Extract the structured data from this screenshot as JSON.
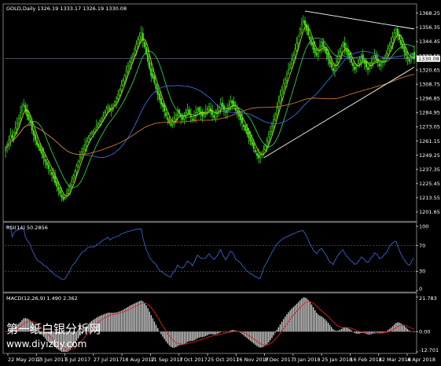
{
  "chart_data": [
    {
      "type": "candlestick",
      "header": "GOLD,Daily  1326.19 1333.17 1326.19 1330.08",
      "symbol": "GOLD",
      "timeframe": "Daily",
      "ohlc_last": {
        "open": 1326.19,
        "high": 1333.17,
        "low": 1326.19,
        "close": 1330.08
      },
      "current_price_label": "1330.08",
      "ylim": [
        1195,
        1374
      ],
      "yticks": [
        "1368.25",
        "1356.35",
        "1344.45",
        "1332.55",
        "1320.65",
        "1308.75",
        "1296.85",
        "1284.95",
        "1273.05",
        "1261.15",
        "1249.25",
        "1237.35",
        "1225.45",
        "1213.55",
        "1201.65"
      ],
      "xticks": [
        "22 May 2017",
        "13 Jun 2017",
        "5 Jul 2017",
        "27 Jul 2017",
        "18 Aug 2017",
        "11 Sep 2017",
        "3 Oct 2017",
        "25 Oct 2017",
        "16 Nov 2017",
        "8 Dec 2017",
        "3 Jan 2018",
        "25 Jan 2018",
        "16 Feb 2018",
        "12 Mar 2018",
        "4 Apr 2018"
      ],
      "close_series": [
        1255,
        1258,
        1262,
        1266,
        1264,
        1268,
        1272,
        1276,
        1280,
        1285,
        1290,
        1292,
        1286,
        1282,
        1279,
        1276,
        1270,
        1266,
        1262,
        1258,
        1256,
        1253,
        1250,
        1247,
        1244,
        1241,
        1238,
        1236,
        1233,
        1230,
        1226,
        1223,
        1220,
        1217,
        1214,
        1212,
        1214,
        1217,
        1220,
        1224,
        1228,
        1232,
        1236,
        1240,
        1244,
        1248,
        1252,
        1255,
        1258,
        1261,
        1264,
        1266,
        1268,
        1269,
        1271,
        1274,
        1276,
        1278,
        1280,
        1282,
        1285,
        1288,
        1290,
        1287,
        1289,
        1291,
        1294,
        1297,
        1300,
        1304,
        1308,
        1312,
        1316,
        1320,
        1324,
        1328,
        1331,
        1334,
        1338,
        1342,
        1346,
        1349,
        1352,
        1345,
        1340,
        1334,
        1328,
        1322,
        1316,
        1314,
        1310,
        1305,
        1300,
        1296,
        1292,
        1290,
        1286,
        1282,
        1279,
        1276,
        1274,
        1277,
        1280,
        1283,
        1286,
        1284,
        1281,
        1279,
        1282,
        1285,
        1287,
        1284,
        1281,
        1279,
        1282,
        1285,
        1288,
        1286,
        1284,
        1282,
        1284,
        1286,
        1288,
        1290,
        1286,
        1283,
        1281,
        1284,
        1287,
        1289,
        1292,
        1290,
        1287,
        1285,
        1288,
        1291,
        1294,
        1293,
        1290,
        1287,
        1285,
        1282,
        1279,
        1276,
        1273,
        1270,
        1267,
        1264,
        1261,
        1258,
        1255,
        1252,
        1249,
        1247,
        1249,
        1251,
        1254,
        1257,
        1261,
        1265,
        1269,
        1274,
        1279,
        1284,
        1289,
        1294,
        1299,
        1304,
        1309,
        1313,
        1317,
        1321,
        1325,
        1329,
        1333,
        1338,
        1343,
        1349,
        1355,
        1359,
        1362,
        1358,
        1354,
        1350,
        1346,
        1342,
        1338,
        1335,
        1333,
        1337,
        1341,
        1344,
        1340,
        1337,
        1334,
        1330,
        1326,
        1323,
        1320,
        1324,
        1328,
        1332,
        1336,
        1340,
        1343,
        1339,
        1336,
        1333,
        1330,
        1327,
        1324,
        1321,
        1323,
        1326,
        1329,
        1332,
        1329,
        1326,
        1323,
        1321,
        1324,
        1327,
        1330,
        1333,
        1330,
        1327,
        1324,
        1326,
        1328,
        1331,
        1334,
        1338,
        1341,
        1344,
        1348,
        1352,
        1355,
        1350,
        1346,
        1342,
        1339,
        1336,
        1333,
        1330,
        1328,
        1331,
        1334,
        1330
      ],
      "indicators": [
        "Moving average (fast)",
        "Moving average (slow)",
        "Moving average (slower)",
        "Moving average (slowest)"
      ],
      "trendlines": [
        {
          "from": "8 Dec 2017",
          "to": "4 Apr 2018",
          "kind": "rising support"
        },
        {
          "from": "25 Jan 2018",
          "to": "4 Apr 2018",
          "kind": "falling resistance"
        }
      ]
    },
    {
      "type": "line",
      "label": "RSI(14) 50.2856",
      "name": "RSI",
      "period": 14,
      "current_value": 50.2856,
      "ylim": [
        0,
        100
      ],
      "yticks": [
        "100",
        "70",
        "30",
        "0"
      ],
      "levels": [
        70,
        30
      ]
    },
    {
      "type": "bar",
      "label": "MACD(12,26,9) 1.490 2.362",
      "name": "MACD",
      "params": [
        12,
        26,
        9
      ],
      "macd_value": 1.49,
      "signal_value": 2.362,
      "ylim": [
        -12.701,
        21.783
      ],
      "yticks": [
        "21.783",
        "0.00",
        "-12.701"
      ]
    }
  ],
  "watermark": {
    "line1": "第一纸白银分析网",
    "line2": "www.diyizby.com"
  }
}
